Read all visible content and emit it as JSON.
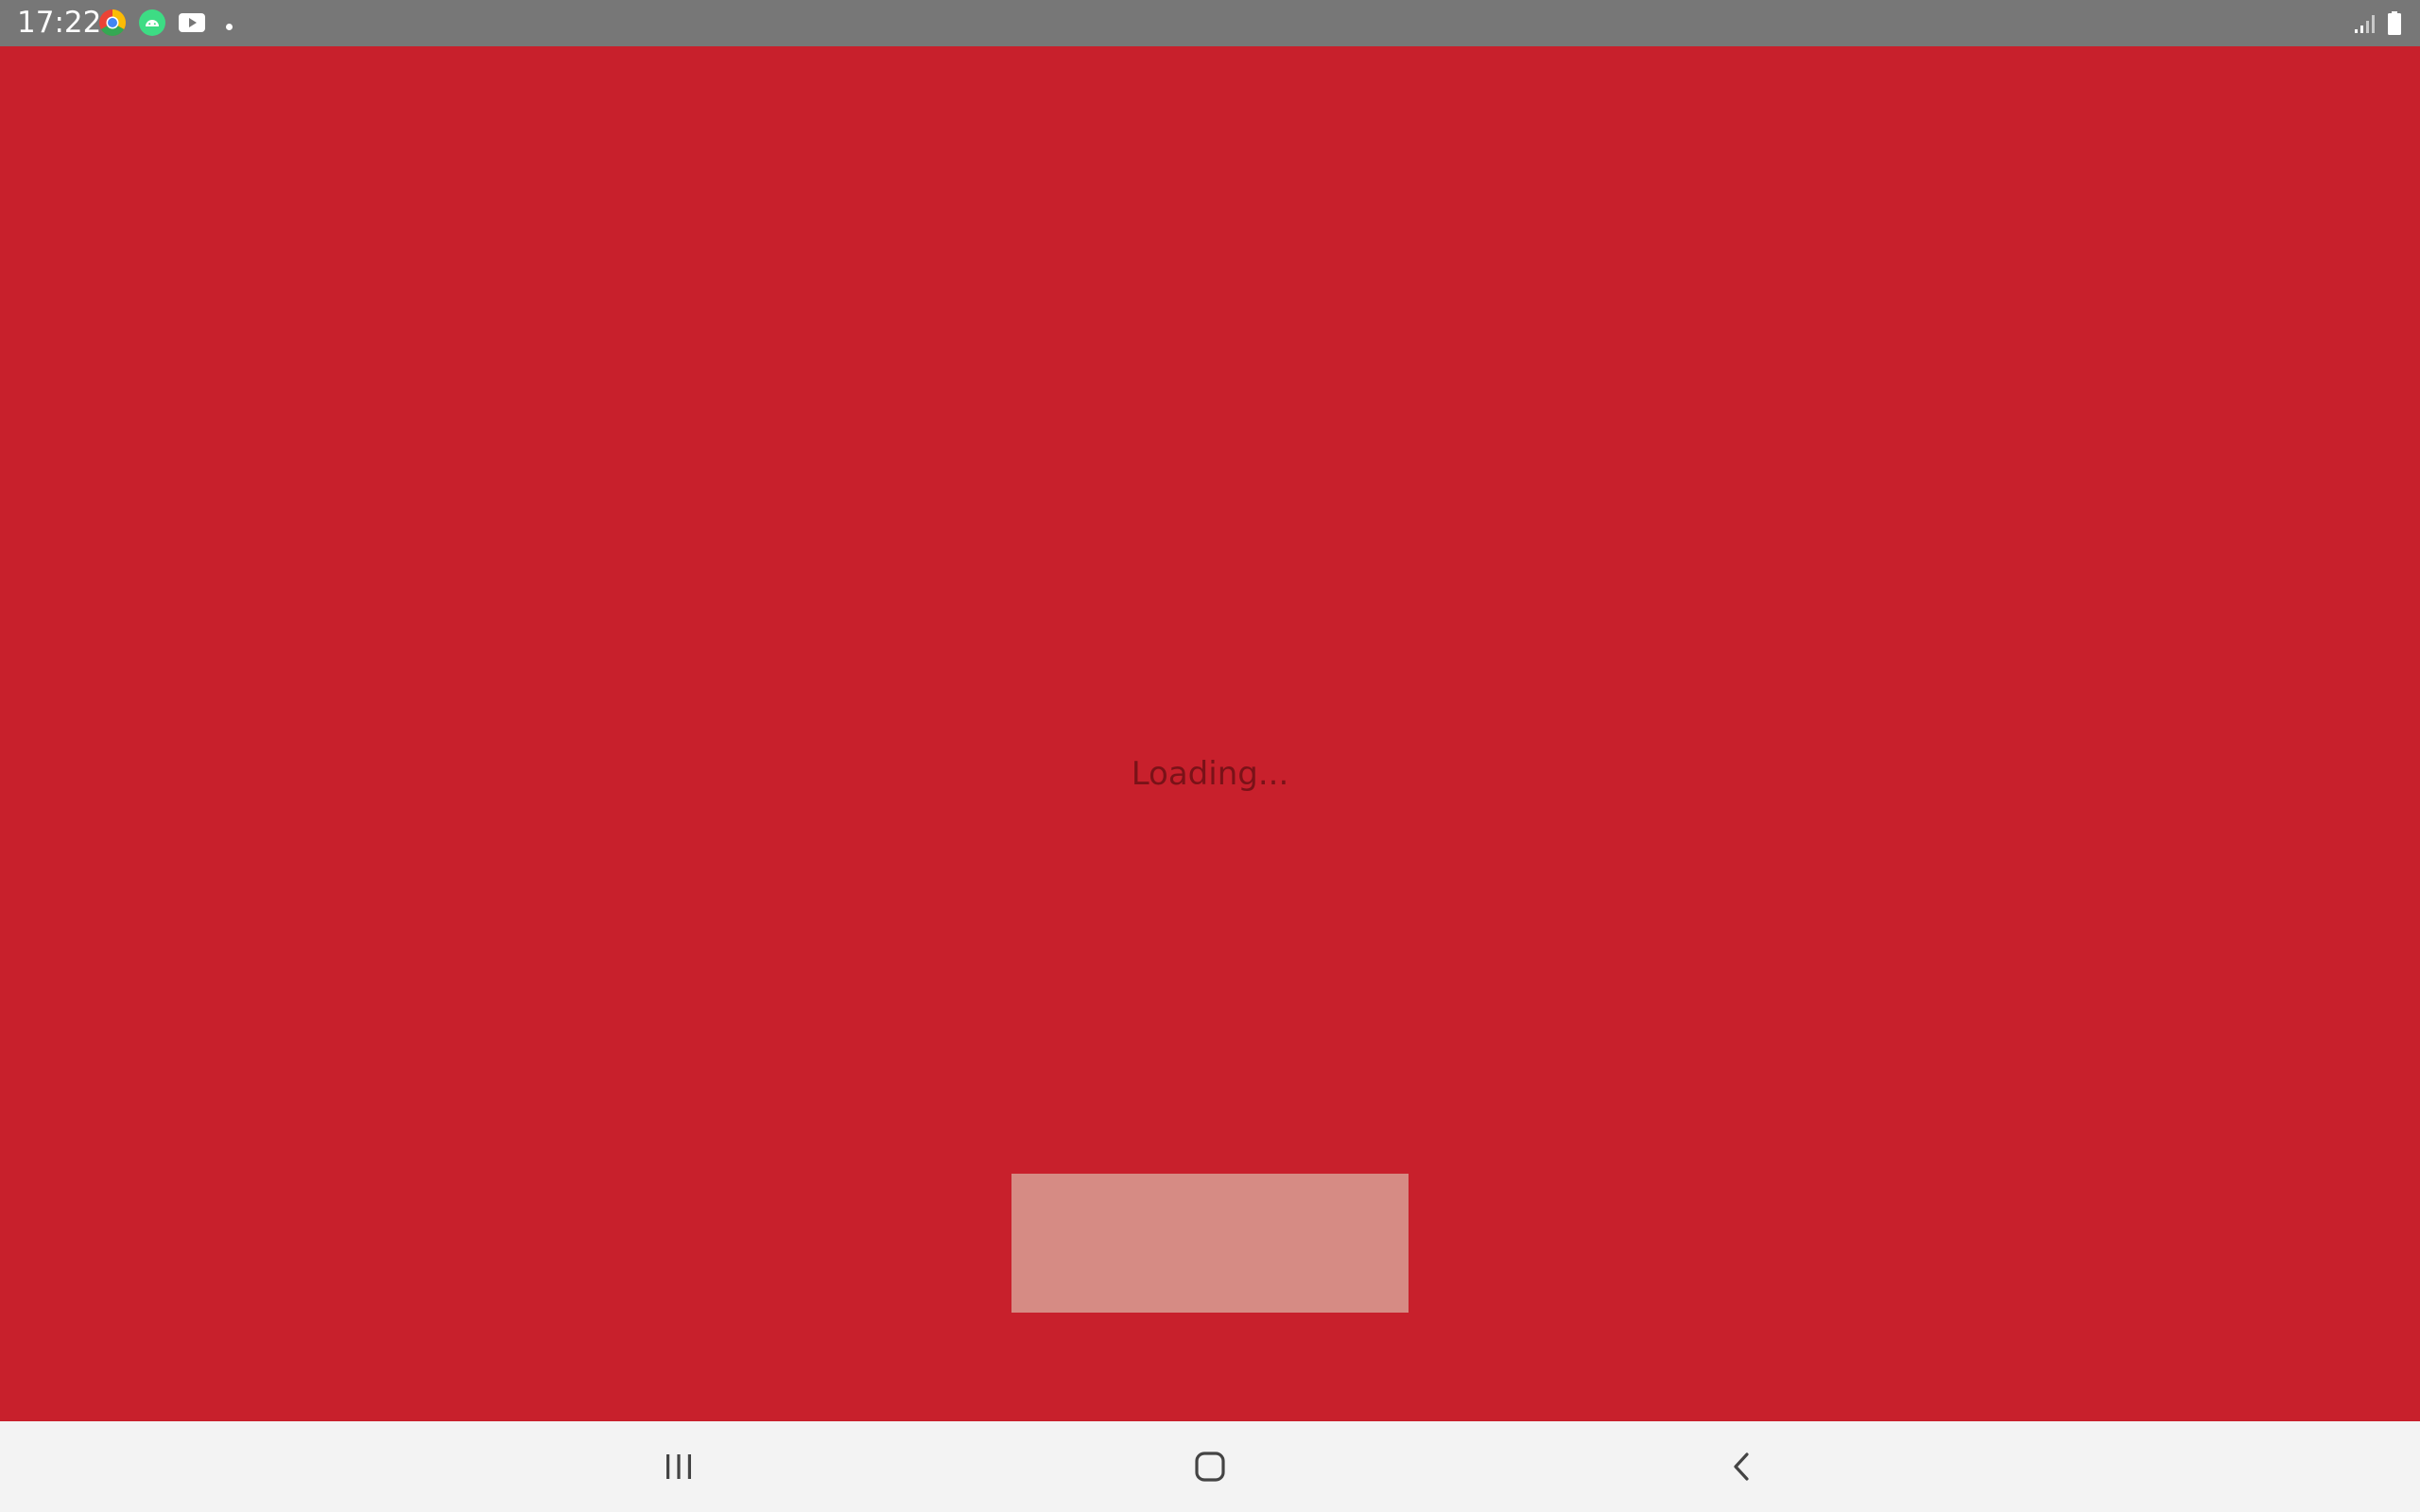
{
  "status_bar": {
    "time": "17:22",
    "notification_icons": [
      "chrome-icon",
      "android-icon",
      "youtube-icon",
      "more-notifications-dot-icon"
    ],
    "system_icons": [
      "signal-icon",
      "battery-icon"
    ],
    "background_color": "#777777"
  },
  "app": {
    "background_color": "#c8202c",
    "loading_text": "Loading...",
    "placeholder_color": "#d68b84"
  },
  "nav_bar": {
    "buttons": [
      "recents-icon",
      "home-icon",
      "back-icon"
    ],
    "background_color": "#f3f3f3"
  }
}
